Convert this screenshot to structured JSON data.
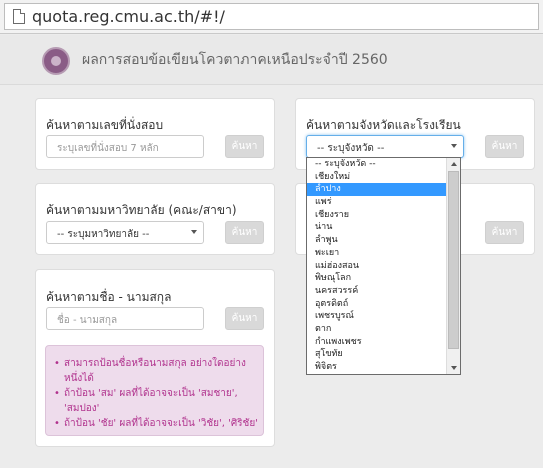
{
  "browser": {
    "url": "quota.reg.cmu.ac.th/#!/"
  },
  "header": {
    "title": "ผลการสอบข้อเขียนโควตาภาคเหนือประจำปี 2560"
  },
  "panels": {
    "seat": {
      "title": "ค้นหาตามเลขที่นั่งสอบ",
      "placeholder": "ระบุเลขที่นั่งสอบ 7 หลัก",
      "button": "ค้นหา"
    },
    "province": {
      "title": "ค้นหาตามจังหวัดและโรงเรียน",
      "select_value": "-- ระบุจังหวัด --",
      "button": "ค้นหา"
    },
    "university": {
      "title": "ค้นหาตามมหาวิทยาลัย (คณะ/สาขา)",
      "select_value": "-- ระบุมหาวิทยาลัย --",
      "button": "ค้นหา"
    },
    "school": {
      "button": "ค้นหา"
    },
    "name": {
      "title": "ค้นหาตามชื่อ - นามสกุล",
      "placeholder": "ชื่อ - นามสกุล",
      "button": "ค้นหา"
    }
  },
  "info": {
    "items": [
      "สามารถป้อนชื่อหรือนามสกุล อย่างใดอย่างหนึ่งได้",
      "ถ้าป้อน 'สม' ผลที่ได้อาจจะเป็น 'สมชาย', 'สมปอง'",
      "ถ้าป้อน 'ชัย' ผลที่ได้อาจจะเป็น 'วิชัย', 'ศิริชัย'"
    ]
  },
  "dropdown": {
    "options": [
      "-- ระบุจังหวัด --",
      "เชียงใหม่",
      "ลำปาง",
      "แพร่",
      "เชียงราย",
      "น่าน",
      "ลำพูน",
      "พะเยา",
      "แม่ฮ่องสอน",
      "พิษณุโลก",
      "นครสวรรค์",
      "อุตรดิตถ์",
      "เพชรบูรณ์",
      "ตาก",
      "กำแพงเพชร",
      "สุโขทัย",
      "พิจิตร"
    ],
    "selected_index": 2
  }
}
